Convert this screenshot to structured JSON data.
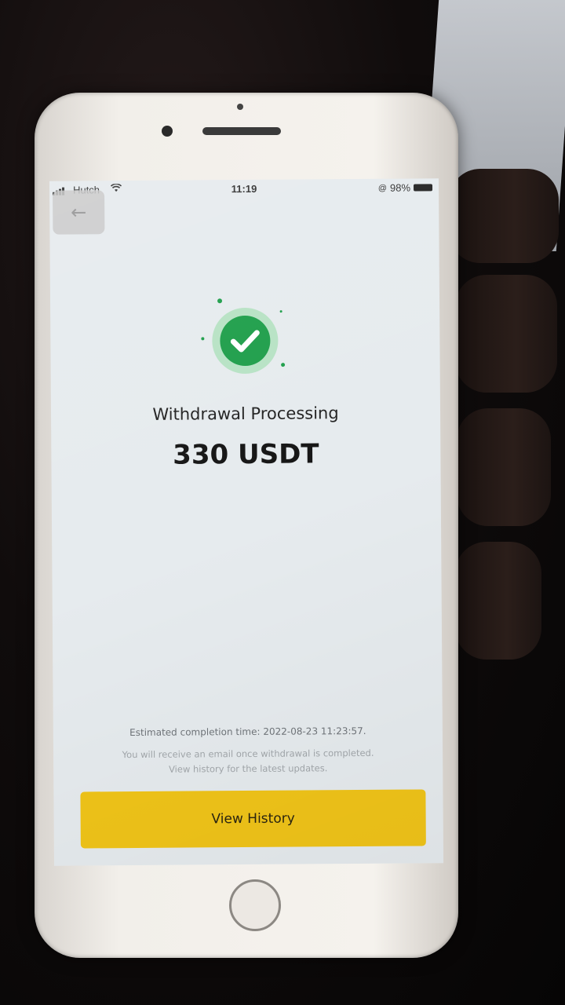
{
  "status_bar": {
    "carrier": "Hutch",
    "time": "11:19",
    "battery": "98%"
  },
  "navigation": {
    "back_icon": "arrow-left-icon"
  },
  "result": {
    "icon": "check-circle-icon",
    "title": "Withdrawal Processing",
    "amount": "330 USDT"
  },
  "info": {
    "estimated": "Estimated completion time: 2022-08-23 11:23:57.",
    "notice_line1": "You will receive an email once withdrawal is completed.",
    "notice_line2": "View history for the latest updates."
  },
  "actions": {
    "view_history_label": "View History"
  },
  "colors": {
    "accent_yellow": "#F0C419",
    "success_green": "#1E9E4A",
    "background": "#E6EBEE"
  }
}
